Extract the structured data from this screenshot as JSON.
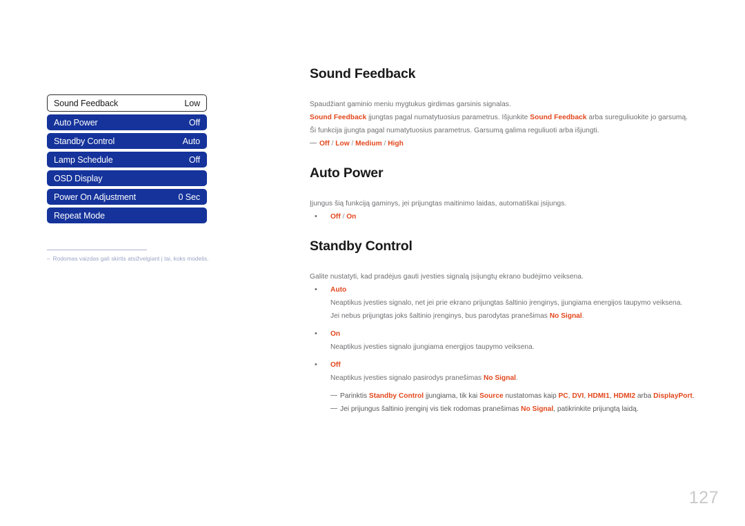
{
  "osd_menu": {
    "rows": [
      {
        "label": "Sound Feedback",
        "value": "Low",
        "state": "selected"
      },
      {
        "label": "Auto Power",
        "value": "Off",
        "state": "normal"
      },
      {
        "label": "Standby Control",
        "value": "Auto",
        "state": "normal"
      },
      {
        "label": "Lamp Schedule",
        "value": "Off",
        "state": "normal"
      },
      {
        "label": "OSD Display",
        "value": "",
        "state": "normal"
      },
      {
        "label": "Power On Adjustment",
        "value": "0 Sec",
        "state": "normal"
      },
      {
        "label": "Repeat Mode",
        "value": "",
        "state": "normal"
      }
    ],
    "footnote": {
      "dash": "–",
      "text": "Rodomas vaizdas gali skirtis atsižvelgiant į tai, koks modelis."
    }
  },
  "sections": {
    "sound_feedback": {
      "heading": "Sound Feedback",
      "para1": "Spaudžiant gaminio meniu mygtukus girdimas garsinis signalas.",
      "para2_a": "Sound Feedback",
      "para2_b": " įjungtas pagal numatytuosius parametrus. Išjunkite ",
      "para2_c": "Sound Feedback",
      "para2_d": " arba sureguliuokite jo garsumą.",
      "para3": "Ši funkcija įjungta pagal numatytuosius parametrus. Garsumą galima reguliuoti arba išjungti.",
      "options": {
        "opt1": "Off",
        "opt2": "Low",
        "opt3": "Medium",
        "opt4": "High",
        "separator": "/"
      }
    },
    "auto_power": {
      "heading": "Auto Power",
      "para1": "Įjungus šią funkciją gaminys, jei prijungtas maitinimo laidas, automatiškai įsijungs.",
      "bullet": "•",
      "options": {
        "opt1": "Off",
        "opt2": "On",
        "separator": "/"
      }
    },
    "standby_control": {
      "heading": "Standby Control",
      "para1": "Galite nustatyti, kad pradėjus gauti įvesties signalą įsijungtų ekrano budėjimo veiksena.",
      "bullet": "•",
      "items": [
        {
          "title": "Auto",
          "line1": "Neaptikus įvesties signalo, net jei prie ekrano prijungtas šaltinio įrenginys, įjungiama energijos taupymo veiksena.",
          "line2_a": "Jei nebus prijungtas joks šaltinio įrenginys, bus parodytas pranešimas ",
          "line2_b": "No Signal",
          "line2_c": "."
        },
        {
          "title": "On",
          "line1": "Neaptikus įvesties signalo įjungiama energijos taupymo veiksena.",
          "line2_a": "",
          "line2_b": "",
          "line2_c": ""
        },
        {
          "title": "Off",
          "line1": "",
          "line2_a": "Neaptikus įvesties signalo pasirodys pranešimas ",
          "line2_b": "No Signal",
          "line2_c": "."
        }
      ],
      "notes": [
        {
          "t1": "Parinktis ",
          "a1": "Standby Control",
          "t2": " įjungiama, tik kai ",
          "a2": "Source",
          "t3": " nustatomas kaip ",
          "a3": "PC",
          "t4": ", ",
          "a4": "DVI",
          "t5": ", ",
          "a5": "HDMI1",
          "t6": ", ",
          "a6": "HDMI2",
          "t7": " arba ",
          "a7": "DisplayPort",
          "t8": "."
        },
        {
          "t1": "Jei prijungus šaltinio įrenginį vis tiek rodomas pranešimas ",
          "a1": "No Signal",
          "t2": ", patikrinkite prijungtą laidą."
        }
      ]
    }
  },
  "page": {
    "number": "127"
  },
  "colors": {
    "accent_orange": "#e2471d",
    "menu_blue": "#15339b",
    "body_gray": "#6d6e71",
    "footnote_gray": "#9aa4c4",
    "page_number_gray": "#c9c9c9"
  }
}
